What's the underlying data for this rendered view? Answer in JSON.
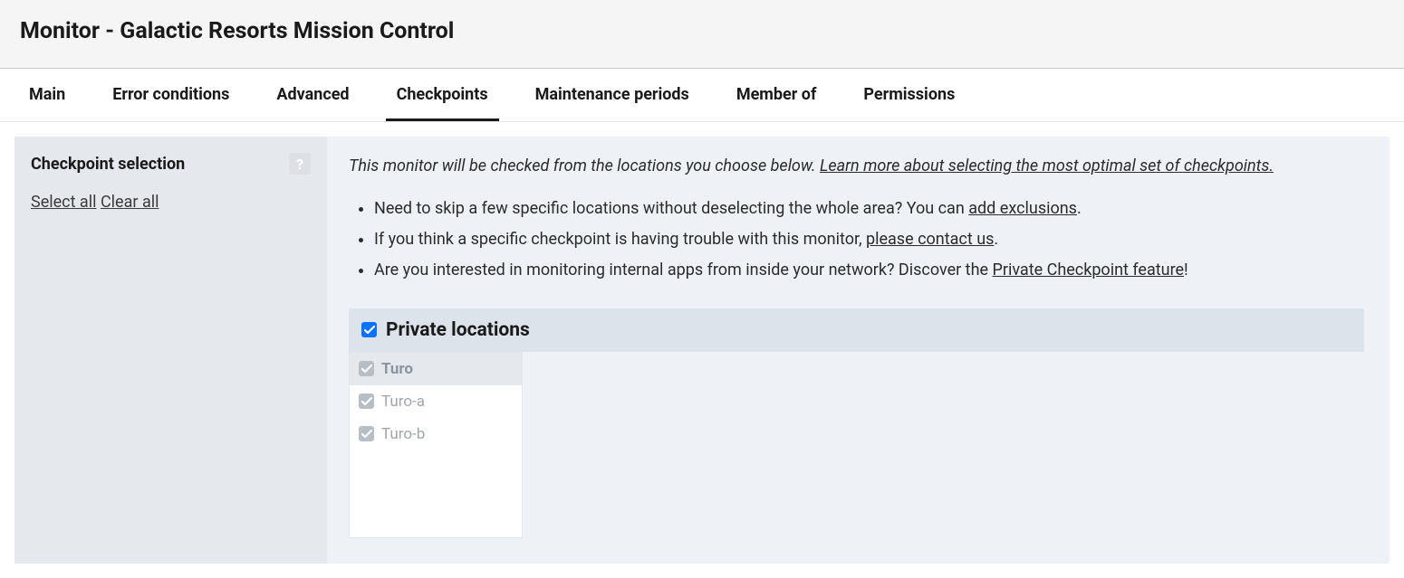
{
  "title": "Monitor - Galactic Resorts Mission Control",
  "tabs": [
    {
      "label": "Main",
      "active": false
    },
    {
      "label": "Error conditions",
      "active": false
    },
    {
      "label": "Advanced",
      "active": false
    },
    {
      "label": "Checkpoints",
      "active": true
    },
    {
      "label": "Maintenance periods",
      "active": false
    },
    {
      "label": "Member of",
      "active": false
    },
    {
      "label": "Permissions",
      "active": false
    }
  ],
  "sidebar": {
    "title": "Checkpoint selection",
    "help_glyph": "?",
    "select_all": "Select all",
    "clear_all": "Clear all"
  },
  "intro": {
    "text": "This monitor will be checked from the locations you choose below. ",
    "link": "Learn more about selecting the most optimal set of checkpoints."
  },
  "bullets": {
    "b1_pre": "Need to skip a few specific locations without deselecting the whole area? You can ",
    "b1_link": "add exclusions",
    "b1_post": ".",
    "b2_pre": "If you think a specific checkpoint is having trouble with this monitor, ",
    "b2_link": "please contact us",
    "b2_post": ".",
    "b3_pre": "Are you interested in monitoring internal apps from inside your network? Discover the ",
    "b3_link": "Private Checkpoint feature",
    "b3_post": "!"
  },
  "section": {
    "title": "Private locations",
    "checked": true
  },
  "locations": {
    "group": "Turo",
    "items": [
      "Turo-a",
      "Turo-b"
    ]
  }
}
